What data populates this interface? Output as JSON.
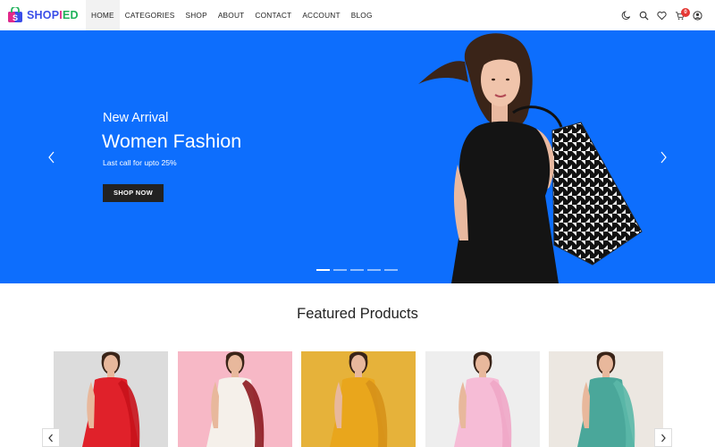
{
  "brand": {
    "logo_parts": [
      "S",
      "H",
      "O",
      "P",
      "I",
      "ED"
    ],
    "colors": {
      "pink": "#e2298a",
      "orange": "#f39c12",
      "green": "#1fb25a",
      "blue": "#3a4ee8"
    }
  },
  "nav": {
    "items": [
      {
        "label": "HOME",
        "active": true
      },
      {
        "label": "CATEGORIES",
        "active": false
      },
      {
        "label": "SHOP",
        "active": false
      },
      {
        "label": "ABOUT",
        "active": false
      },
      {
        "label": "CONTACT",
        "active": false
      },
      {
        "label": "ACCOUNT",
        "active": false
      },
      {
        "label": "BLOG",
        "active": false
      }
    ]
  },
  "header_icons": {
    "theme": "moon-icon",
    "search": "search-icon",
    "wishlist": "heart-icon",
    "cart": "cart-icon",
    "cart_count": "0",
    "account": "user-icon"
  },
  "hero": {
    "subtitle": "New Arrival",
    "title": "Women Fashion",
    "description": "Last call for upto 25%",
    "button_label": "SHOP NOW",
    "background_color": "#0d6efd",
    "slide_count": 5,
    "active_slide": 1
  },
  "featured": {
    "title": "Featured Products",
    "products": [
      {
        "name": "red-anarkali",
        "bg": "#dcdcdc",
        "dress": "#e0212a",
        "scarf": "#c8121b"
      },
      {
        "name": "white-maroon-set",
        "bg": "#f7b8c6",
        "dress": "#f5f0ea",
        "scarf": "#8d1a20"
      },
      {
        "name": "mustard-kurta",
        "bg": "#e6b23a",
        "dress": "#e9a61c",
        "scarf": "#d6911a"
      },
      {
        "name": "pink-kurta",
        "bg": "#eeeeee",
        "dress": "#f6bcd6",
        "scarf": "#f0a6c7"
      },
      {
        "name": "teal-suit",
        "bg": "#ece7e1",
        "dress": "#4aa79a",
        "scarf": "#5bb8a8"
      }
    ]
  }
}
